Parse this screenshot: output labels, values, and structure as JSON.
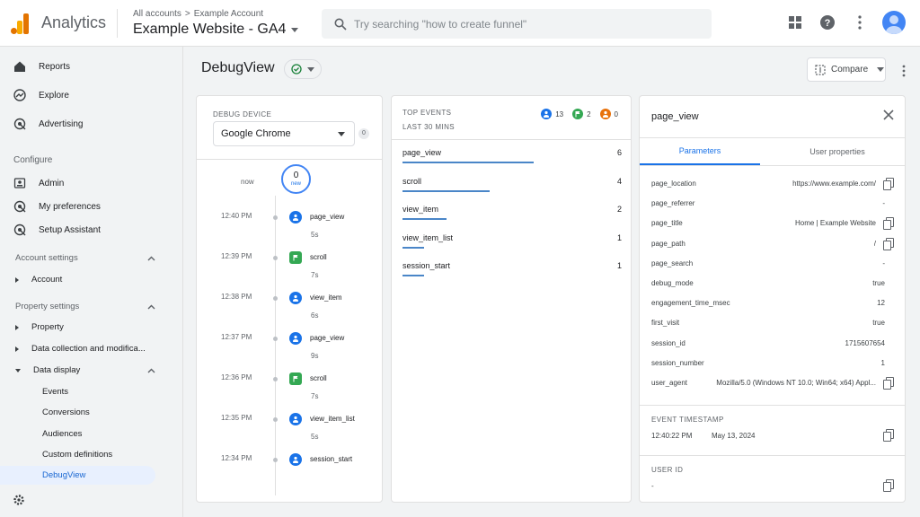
{
  "header": {
    "app_name": "Analytics",
    "breadcrumb": [
      "All accounts",
      "Example Account"
    ],
    "breadcrumb_sep": ">",
    "property": "Example Website - GA4",
    "search_placeholder": "Try searching \"how to create funnel\"",
    "icons": [
      "apps-grid-icon",
      "help-icon",
      "more-vert-icon",
      "account-avatar"
    ]
  },
  "sidebar": {
    "nav": [
      {
        "label": "Reports",
        "icon": "reports-icon"
      },
      {
        "label": "Explore",
        "icon": "explore-icon"
      },
      {
        "label": "Advertising",
        "icon": "advertising-icon"
      }
    ],
    "configure_label": "Configure",
    "configure_items": [
      {
        "label": "Admin",
        "icon": "admin-icon"
      },
      {
        "label": "My preferences",
        "icon": "preferences-icon"
      },
      {
        "label": "Setup Assistant",
        "icon": "setup-icon"
      }
    ],
    "account_settings": "Account settings",
    "account_item": "Account",
    "property_settings": "Property settings",
    "property_items": [
      "Property",
      "Data collection and modifica...",
      "Data display"
    ],
    "data_display_items": [
      "Events",
      "Conversions",
      "Audiences",
      "Custom definitions",
      "DebugView"
    ],
    "active_item": "DebugView"
  },
  "main": {
    "title": "DebugView",
    "compare_label": "Compare"
  },
  "device": {
    "label": "DEBUG DEVICE",
    "selected": "Google Chrome",
    "count": "0",
    "now_label": "now",
    "now_count": "0",
    "now_new": "new",
    "timeline": [
      {
        "time": "12:40 PM",
        "event": "page_view",
        "type": "blue",
        "gap": "5s"
      },
      {
        "time": "12:39 PM",
        "event": "scroll",
        "type": "green",
        "gap": "7s"
      },
      {
        "time": "12:38 PM",
        "event": "view_item",
        "type": "blue",
        "gap": "6s"
      },
      {
        "time": "12:37 PM",
        "event": "page_view",
        "type": "blue",
        "gap": "9s"
      },
      {
        "time": "12:36 PM",
        "event": "scroll",
        "type": "green",
        "gap": "7s"
      },
      {
        "time": "12:35 PM",
        "event": "view_item_list",
        "type": "blue",
        "gap": "5s"
      },
      {
        "time": "12:34 PM",
        "event": "session_start",
        "type": "blue",
        "gap": ""
      }
    ]
  },
  "top_events": {
    "label": "TOP EVENTS",
    "sub": "LAST 30 MINS",
    "counters": [
      {
        "value": "13",
        "color": "#1a73e8",
        "icon": "person-icon"
      },
      {
        "value": "2",
        "color": "#34a853",
        "icon": "flag-icon"
      },
      {
        "value": "0",
        "color": "#e8710a",
        "icon": "alert-icon"
      }
    ],
    "events": [
      {
        "name": "page_view",
        "count": 6
      },
      {
        "name": "scroll",
        "count": 4
      },
      {
        "name": "view_item",
        "count": 2
      },
      {
        "name": "view_item_list",
        "count": 1
      },
      {
        "name": "session_start",
        "count": 1
      }
    ]
  },
  "params": {
    "title": "page_view",
    "tabs": [
      "Parameters",
      "User properties"
    ],
    "rows": [
      {
        "key": "page_location",
        "value": "https://www.example.com/",
        "copy": true
      },
      {
        "key": "page_referrer",
        "value": "-",
        "copy": false
      },
      {
        "key": "page_title",
        "value": "Home | Example Website",
        "copy": true
      },
      {
        "key": "page_path",
        "value": "/",
        "copy": true
      },
      {
        "key": "page_search",
        "value": "-",
        "copy": false
      },
      {
        "key": "debug_mode",
        "value": "true",
        "copy": false
      },
      {
        "key": "engagement_time_msec",
        "value": "12",
        "copy": false
      },
      {
        "key": "first_visit",
        "value": "true",
        "copy": false
      },
      {
        "key": "session_id",
        "value": "1715607654",
        "copy": false
      },
      {
        "key": "session_number",
        "value": "1",
        "copy": false
      },
      {
        "key": "user_agent",
        "value": "Mozilla/5.0 (Windows NT 10.0; Win64; x64) Appl...",
        "copy": true
      }
    ],
    "timestamp_label": "EVENT TIMESTAMP",
    "timestamp_time": "12:40:22 PM",
    "timestamp_date": "May 13, 2024",
    "user_id_label": "USER ID",
    "user_id_value": "-"
  },
  "colors": {
    "accent": "#1a73e8",
    "bar": "#4a86c8",
    "event_blue": "#1a73e8",
    "event_green": "#34a853",
    "logo_orange": "#e37400",
    "logo_yellow": "#f9ab00"
  }
}
